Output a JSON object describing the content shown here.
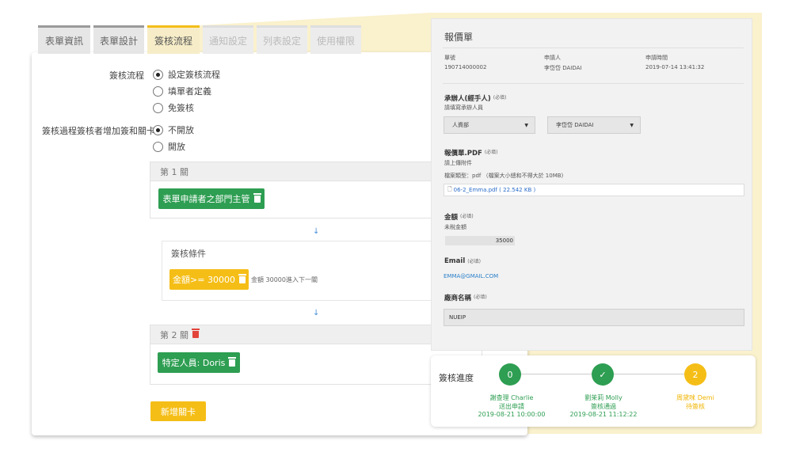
{
  "tabs": [
    {
      "label": "表單資訊"
    },
    {
      "label": "表單設計"
    },
    {
      "label": "簽核流程"
    },
    {
      "label": "通知設定"
    },
    {
      "label": "列表設定"
    },
    {
      "label": "使用權限"
    }
  ],
  "flow": {
    "label": "簽核流程",
    "options": [
      "設定簽核流程",
      "填單者定義",
      "免簽核"
    ],
    "selected": "設定簽核流程"
  },
  "add_sign": {
    "label": "簽核過程簽核者增加簽和關卡",
    "options": [
      "不開放",
      "開放"
    ],
    "selected": "不開放"
  },
  "stage1": {
    "title": "第 1 關",
    "button": "表單申請者之部門主管"
  },
  "condition": {
    "title": "簽核條件",
    "button": "金額>= 30000",
    "note": "金額 30000進入下一關"
  },
  "stage2": {
    "title": "第 2 關",
    "button": "特定人員: Doris"
  },
  "add_stage_button": "新增關卡",
  "quote": {
    "title": "報價單",
    "meta": [
      {
        "label": "單號",
        "value": "190714000002"
      },
      {
        "label": "申請人",
        "value": "李岱岱 DAIDAI"
      },
      {
        "label": "申請時間",
        "value": "2019-07-14 13:41:32"
      }
    ],
    "handler": {
      "label": "承辦人(經手人)",
      "required": "(必填)",
      "hint": "請填寫承辦人員",
      "dept": "人資部",
      "person": "李岱岱 DAIDAI"
    },
    "file": {
      "label": "報價單.PDF",
      "required": "(必填)",
      "hint": "請上傳附件",
      "type_note": "檔案類型：pdf （檔案大小總和不得大於 10MB)",
      "file_name": "06-2_Emma.pdf ( 22.542 KB )"
    },
    "amount": {
      "label": "金額",
      "required": "(必填)",
      "hint": "未稅金額",
      "value": "35000"
    },
    "email": {
      "label": "Email",
      "required": "(必填)",
      "value": "EMMA@GMAIL.COM"
    },
    "vendor": {
      "label": "廠商名稱",
      "required": "(必填)",
      "value": "NUEIP"
    }
  },
  "progress": {
    "label": "簽核進度",
    "steps": [
      {
        "badge": "0",
        "name": "謝查理 Charlie",
        "status": "送出申請",
        "time": "2019-08-21 10:00:00",
        "color": "#2e9e52"
      },
      {
        "badge": "✓",
        "name": "劉茉莉 Molly",
        "status": "簽核通過",
        "time": "2019-08-21 11:12:22",
        "color": "#2e9e52"
      },
      {
        "badge": "2",
        "name": "周黛咪 Demi",
        "status": "待簽核",
        "time": "",
        "color": "#f5be17"
      }
    ]
  },
  "colors": {
    "accent_yellow": "#f5be17",
    "accent_green": "#2e9e52",
    "wedge": "#faf1cd"
  }
}
